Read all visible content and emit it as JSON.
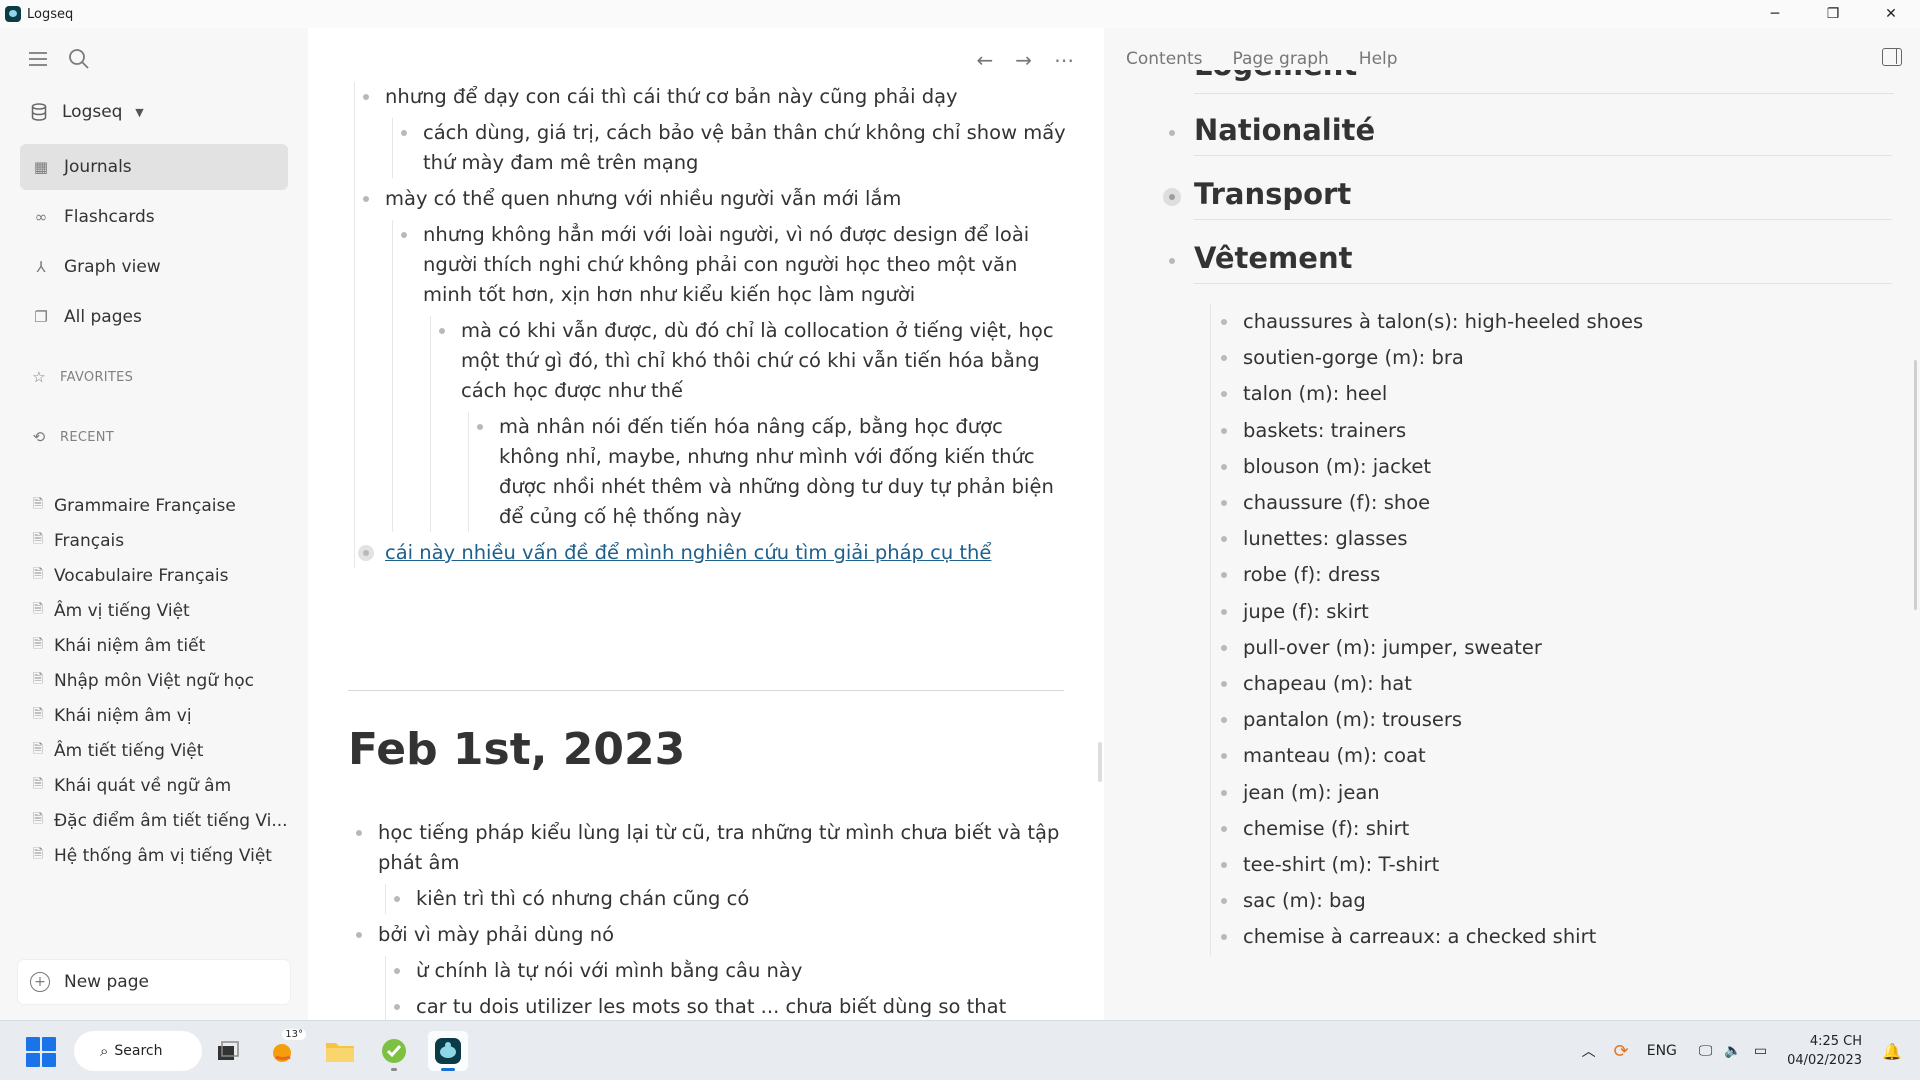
{
  "window": {
    "title": "Logseq",
    "controls": [
      "─",
      "❐",
      "✕"
    ]
  },
  "sidebar": {
    "graph_name": "Logseq",
    "nav": [
      {
        "label": "Journals",
        "icon": "calendar-icon",
        "glyph": "▦"
      },
      {
        "label": "Flashcards",
        "icon": "infinity-icon",
        "glyph": "∞"
      },
      {
        "label": "Graph view",
        "icon": "hierarchy-icon",
        "glyph": "⅄"
      },
      {
        "label": "All pages",
        "icon": "pages-icon",
        "glyph": "❐"
      }
    ],
    "favorites_title": "FAVORITES",
    "recent_title": "RECENT",
    "recent": [
      "Grammaire Française",
      "Français",
      "Vocabulaire Français",
      "Âm vị tiếng Việt",
      "Khái niệm âm tiết",
      "Nhập môn Việt ngữ học",
      "Khái niệm âm vị",
      "Âm tiết tiếng Việt",
      "Khái quát về ngữ âm",
      "Đặc điểm âm tiết tiếng Vi...",
      "Hệ thống âm vị tiếng Việt"
    ],
    "new_page": "New page"
  },
  "main": {
    "blocks_top": {
      "b1": "nhưng để dạy con cái thì cái thứ cơ bản này cũng phải dạy",
      "b1a": "cách dùng, giá trị, cách bảo vệ bản thân chứ không chỉ show mấy thứ mày đam mê trên mạng",
      "b2": "mày có thể quen nhưng với nhiều người vẫn mới lắm",
      "b2a": "nhưng không hẳn mới với loài người, vì nó được design để loài người thích nghi chứ không phải con người học theo một văn minh tốt hơn, xịn hơn như kiểu kiến học làm người",
      "b2a1": "mà có khi vẫn được, dù đó chỉ là collocation ở tiếng việt, học một thứ gì đó, thì chỉ khó thôi chứ có khi vẫn tiến hóa bằng cách học được như thế",
      "b2a1a": "mà nhân nói đến tiến hóa nâng cấp, bằng học được không nhỉ, maybe, nhưng như mình với đống kiến thức được nhồi nhét thêm và những dòng tư duy tự phản biện để củng cố hệ thống này",
      "b3": "cái này nhiều vấn đề để mình nghiên cứu tìm giải pháp cụ thể"
    },
    "journal_title": "Feb 1st, 2023",
    "blocks_feb": {
      "c1": "học tiếng pháp kiểu lùng lại từ cũ, tra những từ mình chưa biết và tập phát âm",
      "c1a": "kiên trì thì có nhưng chán cũng có",
      "c2": "bởi vì mày phải dùng nó",
      "c2a": "ừ chính là tự nói với mình bằng câu này",
      "c2b": "car tu dois utilizer les mots so that ... chưa biết dùng so that"
    }
  },
  "right_sidebar": {
    "tabs": [
      "Contents",
      "Page graph",
      "Help"
    ],
    "partial_heading": "Logement",
    "headings": [
      "Nationalité",
      "Transport",
      "Vêtement"
    ],
    "vocab": [
      "chaussures à talon(s): high-heeled shoes",
      "soutien-gorge (m): bra",
      "talon (m): heel",
      "baskets: trainers",
      "blouson (m): jacket",
      "chaussure (f): shoe",
      "lunettes: glasses",
      "robe (f): dress",
      "jupe (f): skirt",
      "pull-over (m): jumper, sweater",
      "chapeau (m): hat",
      "pantalon (m): trousers",
      "manteau (m): coat",
      "jean (m): jean",
      "chemise (f): shirt",
      "tee-shirt (m): T-shirt",
      "sac (m): bag",
      "chemise à carreaux: a checked shirt"
    ]
  },
  "taskbar": {
    "search_label": "Search",
    "weather": "13°",
    "language": "ENG",
    "time": "4:25 CH",
    "date": "04/02/2023"
  },
  "colors": {
    "accent": "#1a73e8",
    "link": "#1f5f8b",
    "sidebar_bg": "#f7f7f7"
  }
}
